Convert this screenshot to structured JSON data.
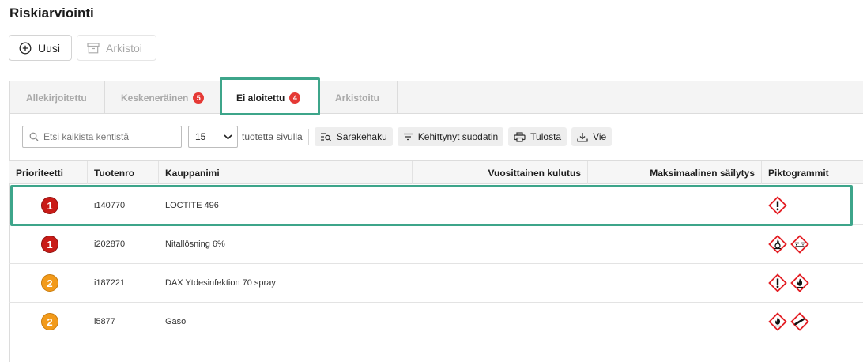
{
  "page": {
    "title": "Riskiarviointi"
  },
  "actions": {
    "new_label": "Uusi",
    "archive_label": "Arkistoi"
  },
  "tabs": [
    {
      "label": "Allekirjoitettu",
      "badge": ""
    },
    {
      "label": "Keskeneräinen",
      "badge": "5"
    },
    {
      "label": "Ei aloitettu",
      "badge": "4"
    },
    {
      "label": "Arkistoitu",
      "badge": ""
    }
  ],
  "active_tab": "Ei aloitettu",
  "toolbar": {
    "search_placeholder": "Etsi kaikista kentistä",
    "per_page_value": "15",
    "per_page_label": "tuotetta sivulla",
    "column_search_label": "Sarakehaku",
    "advanced_filter_label": "Kehittynyt suodatin",
    "print_label": "Tulosta",
    "export_label": "Vie"
  },
  "table": {
    "headers": {
      "priority": "Prioriteetti",
      "product_no": "Tuotenro",
      "trade_name": "Kauppanimi",
      "annual_usage": "Vuosittainen kulutus",
      "max_storage": "Maksimaalinen säilytys",
      "pictograms": "Piktogrammit"
    },
    "rows": [
      {
        "priority": "1",
        "product_no": "i140770",
        "trade_name": "LOCTITE 496",
        "annual_usage": "",
        "max_storage": "",
        "pictograms": [
          "exclamation-mark-icon"
        ]
      },
      {
        "priority": "1",
        "product_no": "i202870",
        "trade_name": "Nitallösning 6%",
        "annual_usage": "",
        "max_storage": "",
        "pictograms": [
          "oxidizer-flame-icon",
          "corrosion-icon"
        ]
      },
      {
        "priority": "2",
        "product_no": "i187221",
        "trade_name": "DAX Ytdesinfektion 70 spray",
        "annual_usage": "",
        "max_storage": "",
        "pictograms": [
          "exclamation-mark-icon",
          "flame-icon"
        ]
      },
      {
        "priority": "2",
        "product_no": "i5877",
        "trade_name": "Gasol",
        "annual_usage": "",
        "max_storage": "",
        "pictograms": [
          "flame-icon",
          "gas-cylinder-icon"
        ]
      }
    ]
  },
  "colors": {
    "highlight": "#3da58a",
    "priority_high": "#c91b17",
    "priority_medium": "#f29a1a",
    "badge": "#e53935",
    "ghs_red": "#e31e24"
  }
}
